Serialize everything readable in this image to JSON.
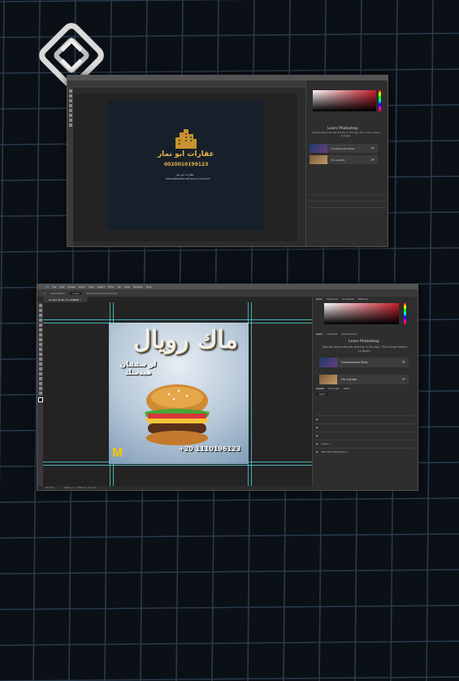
{
  "colors": {
    "background": "#0a1016",
    "grid": "#2a3a4c",
    "panel": "#2e2e2e",
    "accent_gold": "#e0a93a",
    "guide": "#4fd3d8",
    "mcd_yellow": "#f7c600"
  },
  "top_window": {
    "brand_name": "عقارات ابو نمار",
    "brand_phone": "0020010199123",
    "small_lines": [
      "عقارات ابو نمار",
      "WWW.ABONAMAR.COM 0020 10 10199 123"
    ],
    "learn": {
      "title": "Learn Photoshop",
      "subtitle": "Step-by-step tutorials directly in the app. Pick a topic below to begin."
    },
    "cards": [
      {
        "label": "Fundamental Skills",
        "arrow": ">"
      },
      {
        "label": "Fix a photo",
        "arrow": ">"
      }
    ]
  },
  "bottom_window": {
    "menu": [
      "PS",
      "File",
      "Edit",
      "Image",
      "Layer",
      "Type",
      "Select",
      "Filter",
      "3D",
      "View",
      "Window",
      "Help"
    ],
    "options": {
      "tool": "Auto-Select:",
      "target": "Layer",
      "transform": "Show Transform Controls"
    },
    "doc_tab": "01.psd @ 66.7% (RGB/8) *",
    "status_left": "66.67%",
    "status_mid": "1080 px x 1080 px (72 ppi)",
    "panel_tabs": [
      "Color",
      "Swatches",
      "Gradients",
      "Patterns"
    ],
    "learn_tabs": [
      "Learn",
      "Libraries",
      "Adjustments"
    ],
    "learn": {
      "title": "Learn Photoshop",
      "subtitle": "Step-by-step tutorials directly in the app. Pick a topic below to begin."
    },
    "cards": [
      {
        "label": "Fundamental Skills",
        "arrow": ">"
      },
      {
        "label": "Fix a photo",
        "arrow": ">"
      }
    ],
    "layer_tabs": [
      "Layers",
      "Channels",
      "Paths"
    ],
    "layer_kind": "Kind",
    "layers": [
      "",
      "",
      " ",
      "Layer 1",
      "Rounded Rectangle 1"
    ],
    "poster": {
      "title": "ماك رويال",
      "subtitle_line1": "لو سفقان",
      "subtitle_line2": "هيدمنك",
      "phone": "+20 1110196123",
      "logo": "M"
    }
  }
}
